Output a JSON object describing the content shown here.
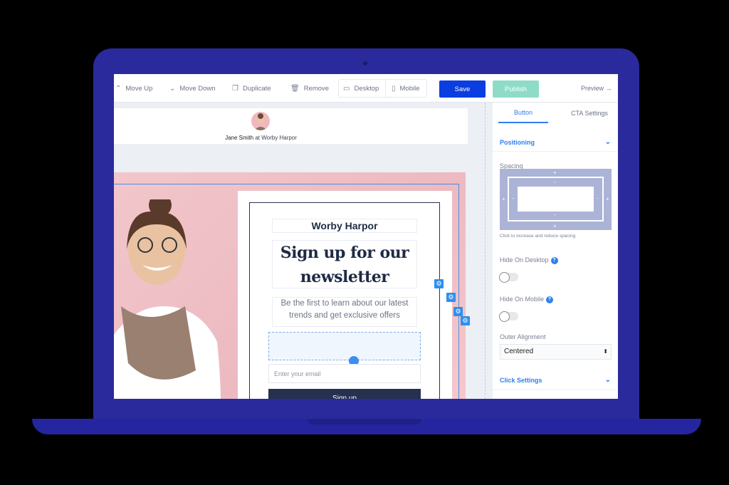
{
  "toolbar": {
    "move_up": "Move Up",
    "move_down": "Move Down",
    "duplicate": "Duplicate",
    "remove": "Remove",
    "desktop": "Desktop",
    "mobile": "Mobile",
    "save": "Save",
    "publish": "Publish",
    "preview": "Preview →"
  },
  "header": {
    "author_name": "Jane Smith",
    "author_sep": "at",
    "author_company": "Worby Harpor"
  },
  "form": {
    "brand": "Worby Harpor",
    "headline": "Sign up for our newsletter",
    "subtext": "Be the first to learn about our latest trends and get exclusive offers",
    "email_placeholder": "Enter your email",
    "submit": "Sign up"
  },
  "panel": {
    "tabs": [
      {
        "label": "Button",
        "active": true
      },
      {
        "label": "CTA Settings",
        "active": false
      }
    ],
    "positioning": "Positioning",
    "spacing_label": "Spacing",
    "spacing_hint": "Click to increase and reduce spacing",
    "hide_desktop": "Hide On Desktop",
    "hide_desktop_on": false,
    "hide_mobile": "Hide On Mobile",
    "hide_mobile_on": false,
    "outer_alignment": "Outer Alignment",
    "outer_alignment_value": "Centered",
    "click_settings": "Click Settings"
  },
  "colors": {
    "accent": "#0b3ee0",
    "publish": "#8edcc8",
    "laptop": "#2a2a9c",
    "submit_bg": "#26314f",
    "link": "#2f7ff0"
  }
}
